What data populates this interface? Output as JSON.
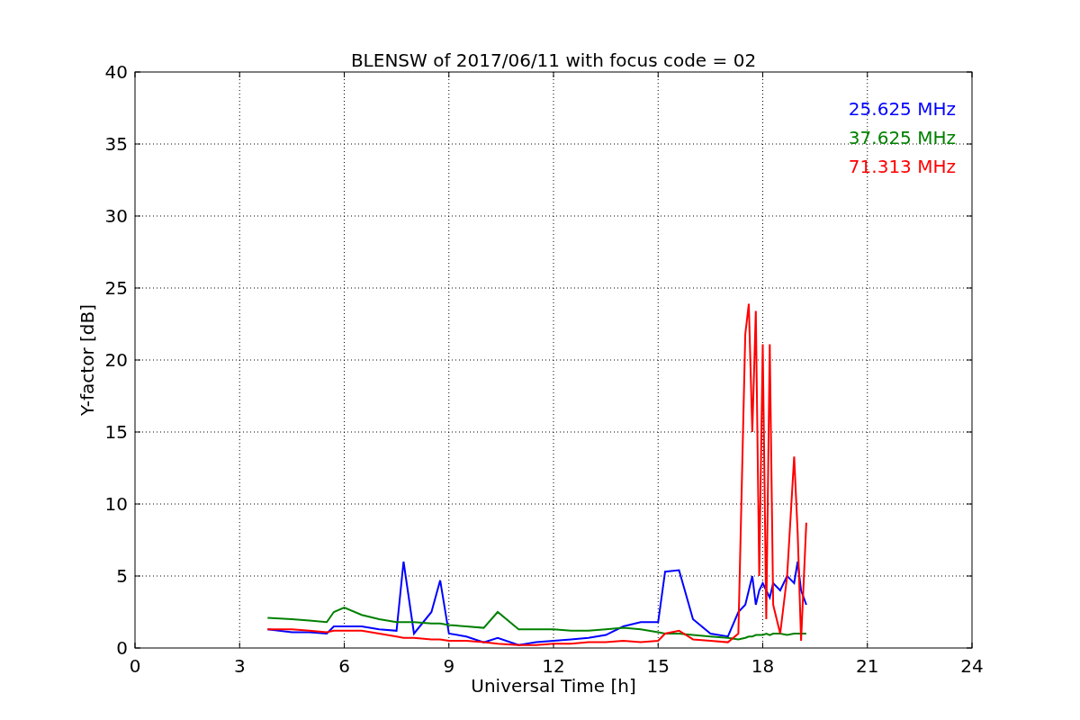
{
  "figure": {
    "chart_data": {
      "type": "line",
      "title": "BLENSW of 2017/06/11 with focus code = 02",
      "xlabel": "Universal Time [h]",
      "ylabel": "Y-factor [dB]",
      "x": [
        3.8,
        4.5,
        5,
        5.5,
        5.7,
        6,
        6.5,
        7,
        7.5,
        7.7,
        8,
        8.5,
        8.75,
        9,
        9.5,
        10,
        10.4,
        11,
        11.5,
        12,
        12.5,
        13,
        13.5,
        14,
        14.5,
        15,
        15.2,
        15.6,
        16,
        16.5,
        17,
        17.3,
        17.5,
        17.6,
        17.7,
        17.8,
        17.9,
        18.0,
        18.1,
        18.2,
        18.3,
        18.5,
        18.7,
        18.9,
        19.0,
        19.1,
        19.25
      ],
      "series": [
        {
          "name": "25.625 MHz",
          "color": "#0000ff",
          "values": [
            1.3,
            1.1,
            1.1,
            1.0,
            1.5,
            1.5,
            1.5,
            1.3,
            1.2,
            6.0,
            1.0,
            2.5,
            4.7,
            1.0,
            0.8,
            0.4,
            0.7,
            0.2,
            0.4,
            0.5,
            0.6,
            0.7,
            0.9,
            1.5,
            1.8,
            1.8,
            5.3,
            5.4,
            2.0,
            1.0,
            0.8,
            2.5,
            3,
            4,
            5,
            3,
            4,
            4.5,
            4,
            3.5,
            4.5,
            4,
            5,
            4.5,
            6,
            4,
            3
          ]
        },
        {
          "name": "37.625 MHz",
          "color": "#008000",
          "values": [
            2.1,
            2.0,
            1.9,
            1.8,
            2.5,
            2.8,
            2.3,
            2.0,
            1.8,
            1.8,
            1.8,
            1.7,
            1.7,
            1.6,
            1.5,
            1.4,
            2.5,
            1.3,
            1.3,
            1.3,
            1.2,
            1.2,
            1.3,
            1.4,
            1.3,
            1.1,
            1.0,
            1.0,
            0.9,
            0.8,
            0.7,
            0.6,
            0.7,
            0.8,
            0.8,
            0.9,
            0.9,
            0.9,
            1.0,
            0.9,
            1.0,
            1.0,
            0.9,
            1.0,
            1.0,
            1.0,
            1.0
          ]
        },
        {
          "name": "71.313 MHz",
          "color": "#ff0000",
          "values": [
            1.3,
            1.3,
            1.2,
            1.1,
            1.2,
            1.2,
            1.2,
            1.0,
            0.8,
            0.7,
            0.7,
            0.6,
            0.6,
            0.5,
            0.5,
            0.4,
            0.3,
            0.2,
            0.2,
            0.3,
            0.3,
            0.4,
            0.4,
            0.5,
            0.4,
            0.5,
            1.0,
            1.2,
            0.6,
            0.5,
            0.4,
            1.0,
            21.8,
            23.9,
            15,
            23.4,
            5,
            21.1,
            2,
            21.1,
            3,
            1,
            5,
            13.3,
            8,
            0.5,
            8.7
          ]
        }
      ],
      "grid": true,
      "xlim": [
        0,
        24
      ],
      "ylim": [
        0,
        40
      ],
      "xticks": [
        0,
        3,
        6,
        9,
        12,
        15,
        18,
        21,
        24
      ],
      "yticks": [
        0,
        5,
        10,
        15,
        20,
        25,
        30,
        35,
        40
      ]
    }
  }
}
